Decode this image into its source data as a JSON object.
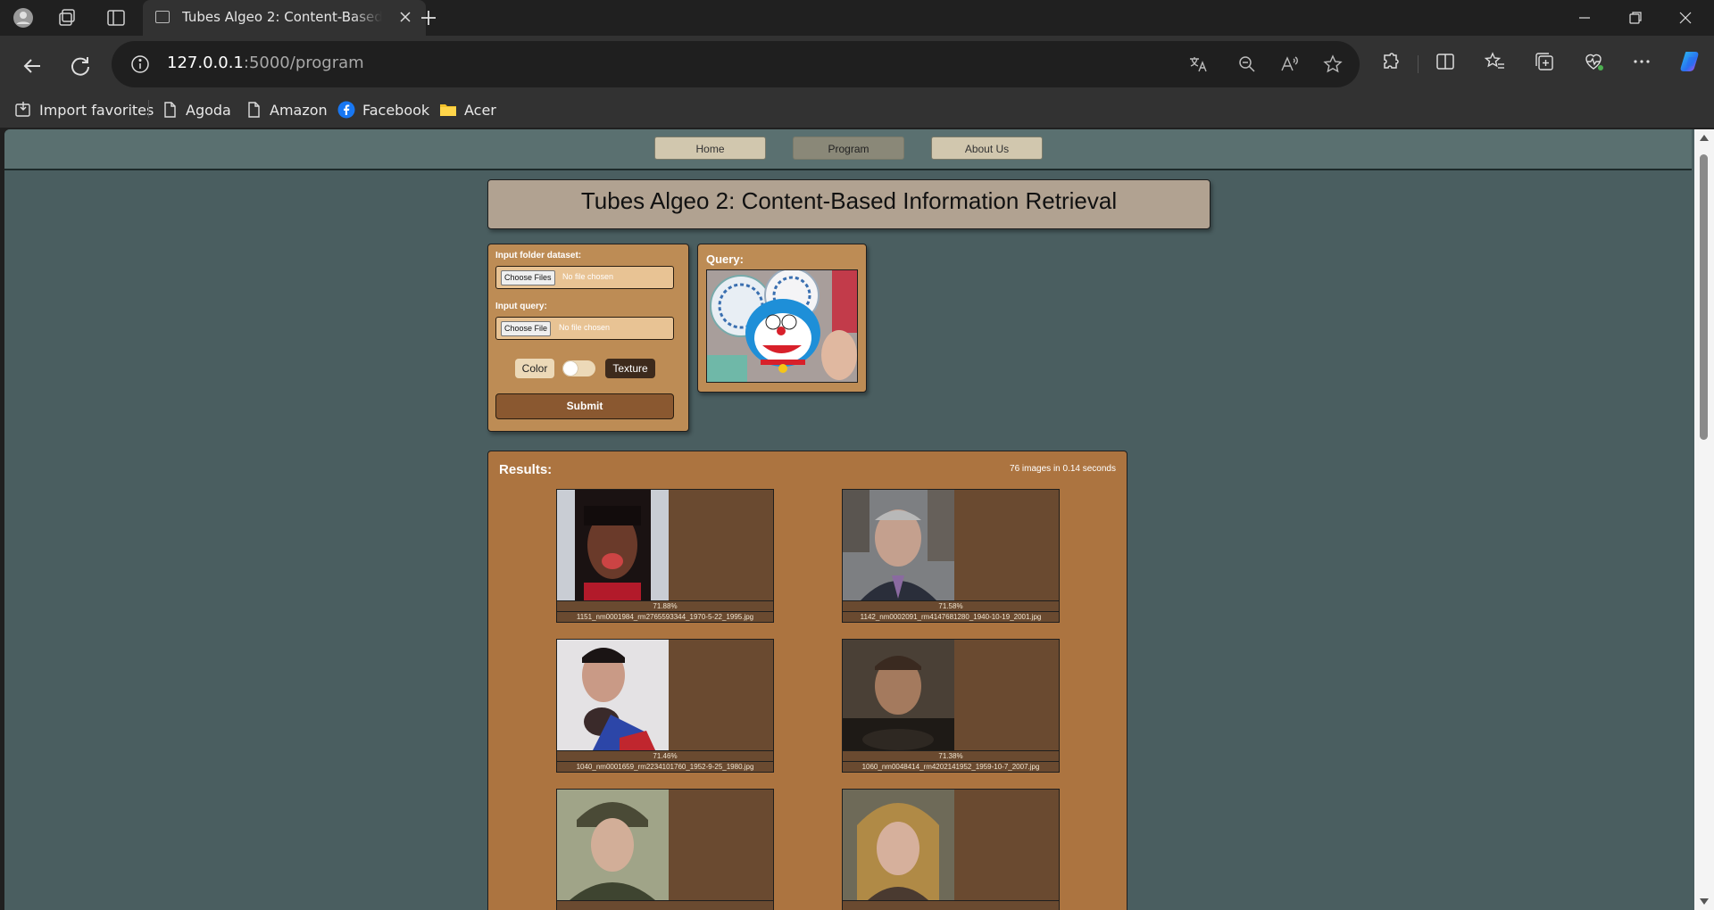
{
  "browser": {
    "tab_title": "Tubes Algeo 2: Content-Based Information Retrieval",
    "url_host": "127.0.0.1",
    "url_path": ":5000/program",
    "favorites": [
      {
        "label": "Import favorites",
        "icon": "import-favorites-icon"
      },
      {
        "label": "Agoda",
        "icon": "page-icon"
      },
      {
        "label": "Amazon",
        "icon": "page-icon"
      },
      {
        "label": "Facebook",
        "icon": "facebook-icon"
      },
      {
        "label": "Acer",
        "icon": "folder-icon"
      }
    ]
  },
  "nav": {
    "links": [
      "Home",
      "Program",
      "About Us"
    ],
    "active": "Program"
  },
  "header": {
    "title": "Tubes Algeo 2: Content-Based Information Retrieval"
  },
  "input_form": {
    "dataset_label": "Input folder dataset:",
    "dataset_button": "Choose Files",
    "dataset_status": "No file chosen",
    "query_label": "Input query:",
    "query_button": "Choose File",
    "query_status": "No file chosen",
    "toggle_left": "Color",
    "toggle_right": "Texture",
    "toggle_state": "color",
    "submit_label": "Submit"
  },
  "query_panel": {
    "label": "Query:"
  },
  "results": {
    "title": "Results:",
    "summary": "76 images in 0.14 seconds",
    "items": [
      {
        "score": "71.88%",
        "filename": "1151_nm0001984_rm2765593344_1970-5-22_1995.jpg"
      },
      {
        "score": "71.58%",
        "filename": "1142_nm0002091_rm4147681280_1940-10-19_2001.jpg"
      },
      {
        "score": "71.46%",
        "filename": "1040_nm0001659_rm2234101760_1952-9-25_1980.jpg"
      },
      {
        "score": "71.38%",
        "filename": "1060_nm0048414_rm4202141952_1959-10-7_2007.jpg"
      },
      {
        "score": "",
        "filename": ""
      },
      {
        "score": "",
        "filename": ""
      }
    ]
  },
  "colors": {
    "page_bg": "#4a5e60",
    "card_bg": "#bd8c55",
    "results_bg": "#ac7440",
    "header_bg": "#b1a291"
  }
}
